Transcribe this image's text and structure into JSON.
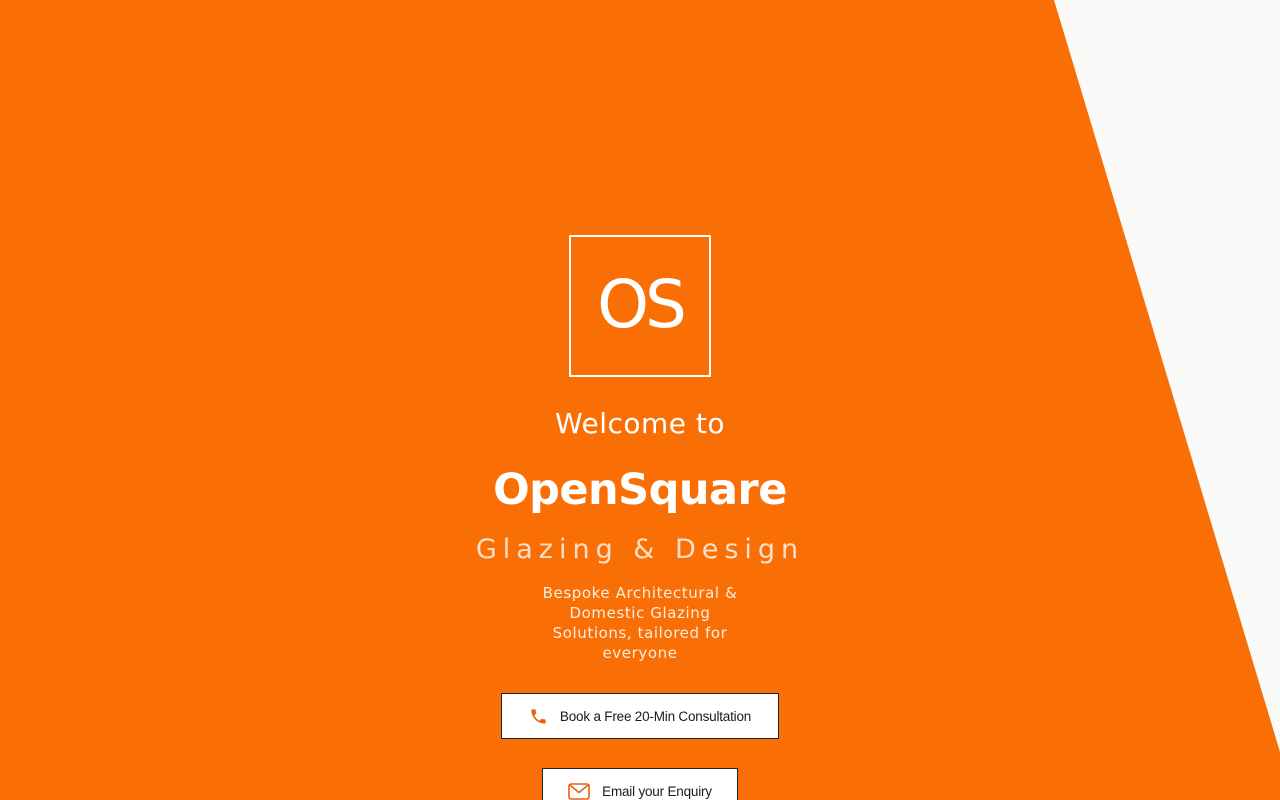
{
  "colors": {
    "brand_orange": "#F96F06",
    "background_light": "#FAFAF8",
    "text_light": "#FFFFFF",
    "button_bg": "#FFFFFF",
    "button_text": "#1A1A1A"
  },
  "logo": {
    "text": "OS"
  },
  "hero": {
    "welcome": "Welcome to",
    "brand_name": "OpenSquare",
    "tagline": "Glazing & Design",
    "description": "Bespoke Architectural & Domestic Glazing Solutions, tailored for everyone"
  },
  "buttons": {
    "consultation": {
      "label": "Book a Free 20-Min Consultation",
      "icon": "phone-icon"
    },
    "email": {
      "label": "Email your Enquiry",
      "icon": "envelope-icon"
    }
  }
}
